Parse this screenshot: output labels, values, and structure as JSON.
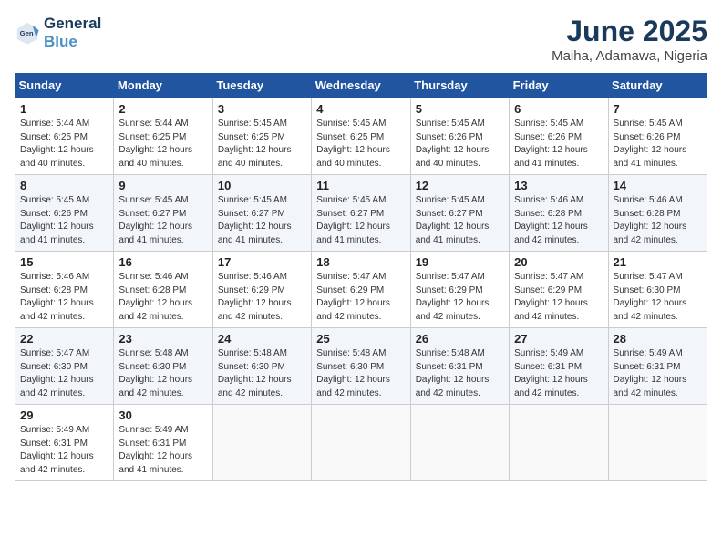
{
  "header": {
    "logo_line1": "General",
    "logo_line2": "Blue",
    "month": "June 2025",
    "location": "Maiha, Adamawa, Nigeria"
  },
  "weekdays": [
    "Sunday",
    "Monday",
    "Tuesday",
    "Wednesday",
    "Thursday",
    "Friday",
    "Saturday"
  ],
  "weeks": [
    [
      {
        "day": "1",
        "sunrise": "5:44 AM",
        "sunset": "6:25 PM",
        "daylight": "12 hours and 40 minutes."
      },
      {
        "day": "2",
        "sunrise": "5:44 AM",
        "sunset": "6:25 PM",
        "daylight": "12 hours and 40 minutes."
      },
      {
        "day": "3",
        "sunrise": "5:45 AM",
        "sunset": "6:25 PM",
        "daylight": "12 hours and 40 minutes."
      },
      {
        "day": "4",
        "sunrise": "5:45 AM",
        "sunset": "6:25 PM",
        "daylight": "12 hours and 40 minutes."
      },
      {
        "day": "5",
        "sunrise": "5:45 AM",
        "sunset": "6:26 PM",
        "daylight": "12 hours and 40 minutes."
      },
      {
        "day": "6",
        "sunrise": "5:45 AM",
        "sunset": "6:26 PM",
        "daylight": "12 hours and 41 minutes."
      },
      {
        "day": "7",
        "sunrise": "5:45 AM",
        "sunset": "6:26 PM",
        "daylight": "12 hours and 41 minutes."
      }
    ],
    [
      {
        "day": "8",
        "sunrise": "5:45 AM",
        "sunset": "6:26 PM",
        "daylight": "12 hours and 41 minutes."
      },
      {
        "day": "9",
        "sunrise": "5:45 AM",
        "sunset": "6:27 PM",
        "daylight": "12 hours and 41 minutes."
      },
      {
        "day": "10",
        "sunrise": "5:45 AM",
        "sunset": "6:27 PM",
        "daylight": "12 hours and 41 minutes."
      },
      {
        "day": "11",
        "sunrise": "5:45 AM",
        "sunset": "6:27 PM",
        "daylight": "12 hours and 41 minutes."
      },
      {
        "day": "12",
        "sunrise": "5:45 AM",
        "sunset": "6:27 PM",
        "daylight": "12 hours and 41 minutes."
      },
      {
        "day": "13",
        "sunrise": "5:46 AM",
        "sunset": "6:28 PM",
        "daylight": "12 hours and 42 minutes."
      },
      {
        "day": "14",
        "sunrise": "5:46 AM",
        "sunset": "6:28 PM",
        "daylight": "12 hours and 42 minutes."
      }
    ],
    [
      {
        "day": "15",
        "sunrise": "5:46 AM",
        "sunset": "6:28 PM",
        "daylight": "12 hours and 42 minutes."
      },
      {
        "day": "16",
        "sunrise": "5:46 AM",
        "sunset": "6:28 PM",
        "daylight": "12 hours and 42 minutes."
      },
      {
        "day": "17",
        "sunrise": "5:46 AM",
        "sunset": "6:29 PM",
        "daylight": "12 hours and 42 minutes."
      },
      {
        "day": "18",
        "sunrise": "5:47 AM",
        "sunset": "6:29 PM",
        "daylight": "12 hours and 42 minutes."
      },
      {
        "day": "19",
        "sunrise": "5:47 AM",
        "sunset": "6:29 PM",
        "daylight": "12 hours and 42 minutes."
      },
      {
        "day": "20",
        "sunrise": "5:47 AM",
        "sunset": "6:29 PM",
        "daylight": "12 hours and 42 minutes."
      },
      {
        "day": "21",
        "sunrise": "5:47 AM",
        "sunset": "6:30 PM",
        "daylight": "12 hours and 42 minutes."
      }
    ],
    [
      {
        "day": "22",
        "sunrise": "5:47 AM",
        "sunset": "6:30 PM",
        "daylight": "12 hours and 42 minutes."
      },
      {
        "day": "23",
        "sunrise": "5:48 AM",
        "sunset": "6:30 PM",
        "daylight": "12 hours and 42 minutes."
      },
      {
        "day": "24",
        "sunrise": "5:48 AM",
        "sunset": "6:30 PM",
        "daylight": "12 hours and 42 minutes."
      },
      {
        "day": "25",
        "sunrise": "5:48 AM",
        "sunset": "6:30 PM",
        "daylight": "12 hours and 42 minutes."
      },
      {
        "day": "26",
        "sunrise": "5:48 AM",
        "sunset": "6:31 PM",
        "daylight": "12 hours and 42 minutes."
      },
      {
        "day": "27",
        "sunrise": "5:49 AM",
        "sunset": "6:31 PM",
        "daylight": "12 hours and 42 minutes."
      },
      {
        "day": "28",
        "sunrise": "5:49 AM",
        "sunset": "6:31 PM",
        "daylight": "12 hours and 42 minutes."
      }
    ],
    [
      {
        "day": "29",
        "sunrise": "5:49 AM",
        "sunset": "6:31 PM",
        "daylight": "12 hours and 42 minutes."
      },
      {
        "day": "30",
        "sunrise": "5:49 AM",
        "sunset": "6:31 PM",
        "daylight": "12 hours and 41 minutes."
      },
      null,
      null,
      null,
      null,
      null
    ]
  ]
}
